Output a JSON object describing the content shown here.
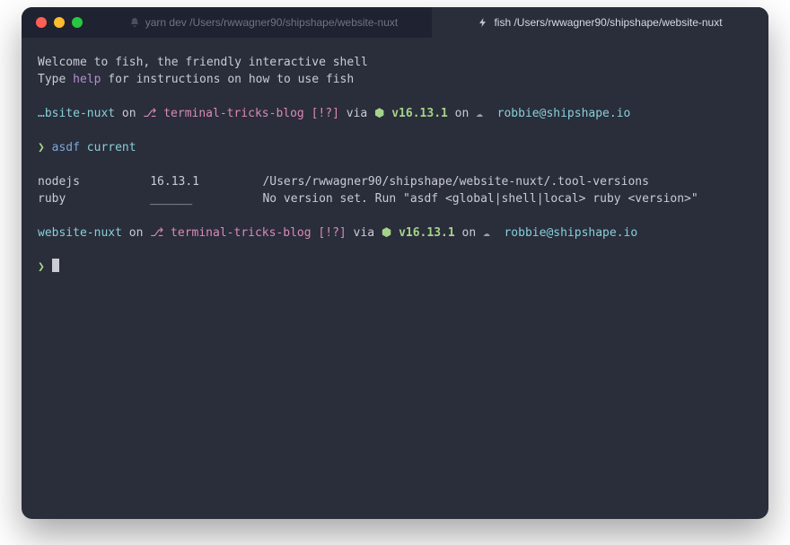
{
  "tabs": [
    {
      "label": "yarn dev /Users/rwwagner90/shipshape/website-nuxt",
      "active": false
    },
    {
      "label": "fish /Users/rwwagner90/shipshape/website-nuxt",
      "active": true
    }
  ],
  "welcome": {
    "line1": "Welcome to fish, the friendly interactive shell",
    "line2a": "Type ",
    "line2_help": "help",
    "line2b": " for instructions on how to use fish"
  },
  "prompt1": {
    "dir": "…bsite-nuxt",
    "on": " on ",
    "branch_icon": "⎇ ",
    "branch": "terminal-tricks-blog",
    "status": " [!?]",
    "via": " via ",
    "node_icon": "⬢ ",
    "node": "v16.13.1",
    "cloud_on": " on ",
    "cloud_icon": "☁  ",
    "user": "robbie@shipshape.io"
  },
  "command": {
    "caret": "❯ ",
    "cmd": "asdf",
    "space": " ",
    "arg": "current"
  },
  "output": {
    "row1": "nodejs          16.13.1         /Users/rwwagner90/shipshape/website-nuxt/.tool-versions",
    "row2": "ruby            ______          No version set. Run \"asdf <global|shell|local> ruby <version>\""
  },
  "prompt2": {
    "dir": "website-nuxt",
    "on": " on ",
    "branch_icon": "⎇ ",
    "branch": "terminal-tricks-blog",
    "status": " [!?]",
    "via": " via ",
    "node_icon": "⬢ ",
    "node": "v16.13.1",
    "cloud_on": " on ",
    "cloud_icon": "☁  ",
    "user": "robbie@shipshape.io"
  },
  "prompt2_caret": "❯ "
}
